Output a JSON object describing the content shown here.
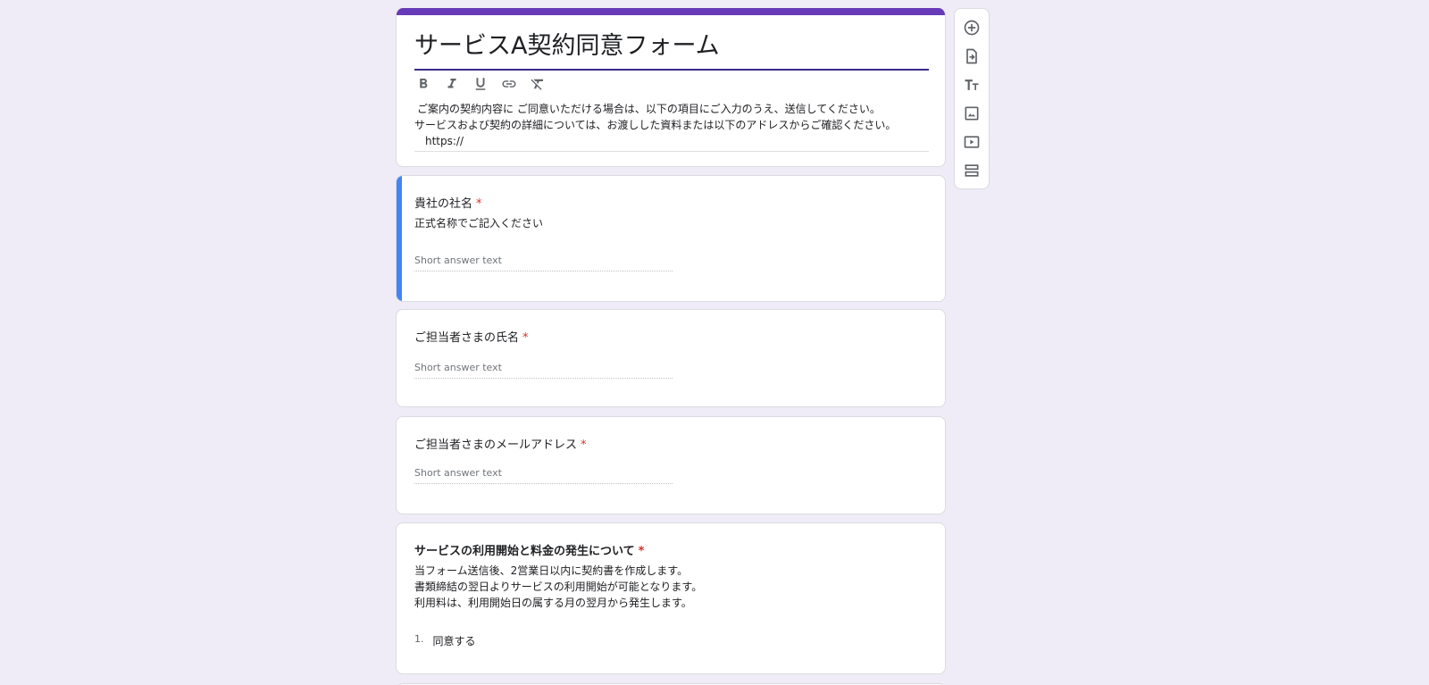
{
  "form": {
    "title": "サービスA契約同意フォーム",
    "description_lines": [
      "ご案内の契約内容に ご同意いただける場合は、以下の項目にご入力のうえ、送信してください。",
      "サービスおよび契約の詳細については、お渡しした資料または以下のアドレスからご確認ください。",
      "https://"
    ]
  },
  "format_toolbar": {
    "items": [
      "bold-icon",
      "italic-icon",
      "underline-icon",
      "link-icon",
      "clear-format-icon"
    ]
  },
  "questions": {
    "company": {
      "title": "貴社の社名",
      "required_mark": "*",
      "help": "正式名称でご記入ください",
      "placeholder": "Short answer text"
    },
    "name": {
      "title": "ご担当者さまの氏名",
      "required_mark": "*",
      "placeholder": "Short answer text"
    },
    "email": {
      "title": "ご担当者さまのメールアドレス",
      "required_mark": "*",
      "placeholder": "Short answer text"
    },
    "terms": {
      "title": "サービスの利用開始と料金の発生について",
      "required_mark": "*",
      "help_lines": [
        "当フォーム送信後、2営業日以内に契約書を作成します。",
        "書類締結の翌日よりサービスの利用開始が可能となります。",
        "利用料は、利用開始日の属する月の翌月から発生します。"
      ],
      "options": [
        {
          "number": "1.",
          "label": "同意する"
        }
      ]
    }
  },
  "side_toolbar": {
    "items": [
      "add-question-icon",
      "import-questions-icon",
      "add-title-icon",
      "add-image-icon",
      "add-video-icon",
      "add-section-icon"
    ]
  },
  "colors": {
    "background": "#efebf7",
    "theme": "#673ab7",
    "active": "#4285f4",
    "required": "#d93025"
  }
}
